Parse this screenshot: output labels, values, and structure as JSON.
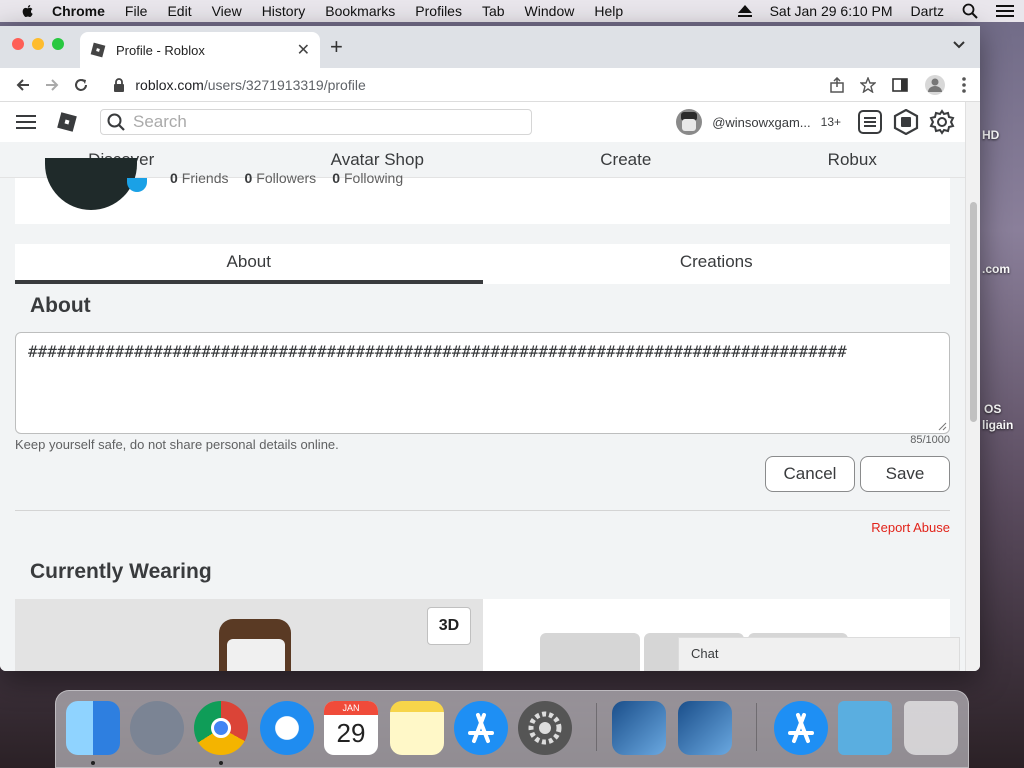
{
  "menubar": {
    "app_name": "Chrome",
    "items": [
      "File",
      "Edit",
      "View",
      "History",
      "Bookmarks",
      "Profiles",
      "Tab",
      "Window",
      "Help"
    ],
    "datetime": "Sat Jan 29  6:10 PM",
    "user": "Dartz"
  },
  "browser": {
    "tab_title": "Profile - Roblox",
    "url_host": "roblox.com",
    "url_path": "/users/3271913319/profile"
  },
  "desktop": {
    "labels": [
      "HD",
      ".com",
      "OS",
      "ligain"
    ]
  },
  "roblox": {
    "search_placeholder": "Search",
    "username": "@winsowxgam...",
    "age_badge": "13+",
    "nav": [
      "Discover",
      "Avatar Shop",
      "Create",
      "Robux"
    ],
    "stats": {
      "friends_count": "0",
      "friends_label": "Friends",
      "followers_count": "0",
      "followers_label": "Followers",
      "following_count": "0",
      "following_label": "Following"
    },
    "tabs": [
      "About",
      "Creations"
    ],
    "about_title": "About",
    "about_text": "#####################################################################################",
    "helper_text": "Keep yourself safe, do not share personal details online.",
    "char_counter": "85/1000",
    "cancel_label": "Cancel",
    "save_label": "Save",
    "report_label": "Report Abuse",
    "wearing_title": "Currently Wearing",
    "btn_3d": "3D",
    "chat_label": "Chat"
  },
  "dock": {
    "calendar_month": "JAN",
    "calendar_day": "29"
  }
}
